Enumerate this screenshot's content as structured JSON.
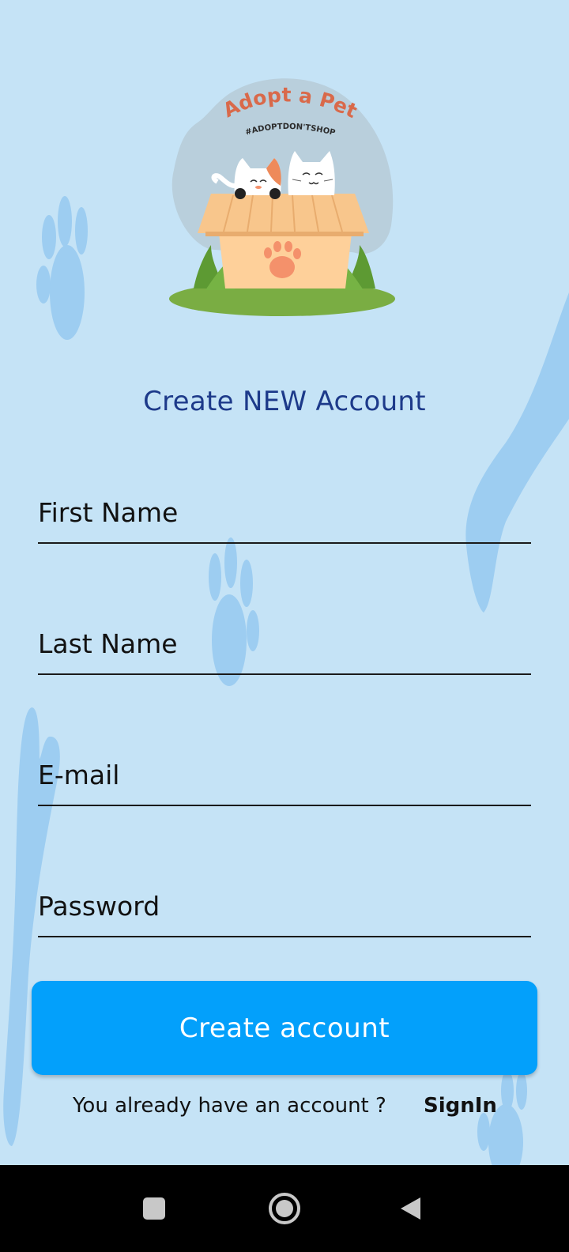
{
  "logo": {
    "title": "Adopt a Pet",
    "tagline": "#ADOPTDON'TSHOP"
  },
  "form": {
    "heading": "Create NEW Account",
    "first_name_placeholder": "First Name",
    "last_name_placeholder": "Last Name",
    "email_placeholder": "E-mail",
    "password_placeholder": "Password",
    "submit_label": "Create account"
  },
  "footer": {
    "prompt": "You already have an account ?",
    "signin_label": "SignIn"
  },
  "navbar": {
    "icons": [
      "recent-apps-icon",
      "home-icon",
      "back-icon"
    ]
  },
  "colors": {
    "background": "#c5e3f6",
    "paw_print": "#9dcdf1",
    "heading": "#1d3a8a",
    "primary_button": "#03a0fb",
    "logo_text": "#d9694a",
    "navbar": "#000000"
  }
}
